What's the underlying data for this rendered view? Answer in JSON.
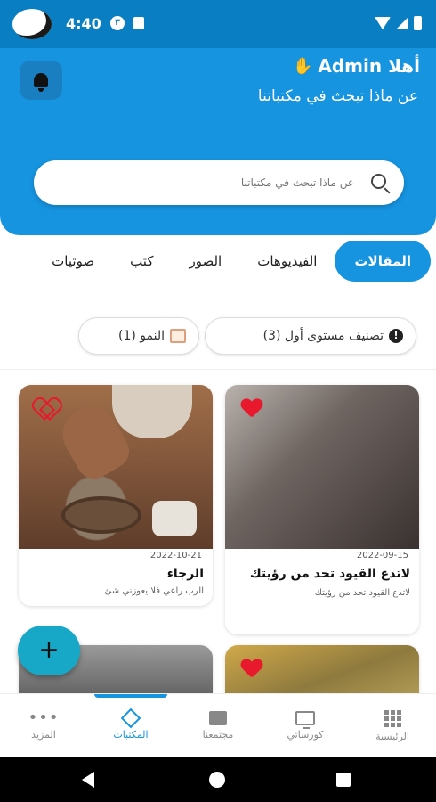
{
  "status_bar": {
    "time": "4:40",
    "notif_badge": "۳"
  },
  "header": {
    "greeting": "أهلا Admin",
    "subtitle": "عن ماذا تبحث في مكتباتنا",
    "search_placeholder": "عن ماذا تبحث في مكتباتنا"
  },
  "tabs": [
    {
      "label": "المقالات",
      "active": true
    },
    {
      "label": "الفيديوهات",
      "active": false
    },
    {
      "label": "الصور",
      "active": false
    },
    {
      "label": "كتب",
      "active": false
    },
    {
      "label": "صوتيات",
      "active": false
    }
  ],
  "filters": [
    {
      "label": "تصنيف مستوى أول (3)",
      "icon": "info-icon"
    },
    {
      "label": "النمو (1)",
      "icon": "calendar-icon"
    }
  ],
  "cards": [
    {
      "date": "2022-09-15",
      "title": "لاتدع القيود تحد من رؤيتك",
      "excerpt": "لاتدع القيود تحد من رؤيتك",
      "favorite": true
    },
    {
      "date": "2022-10-21",
      "title": "الرجاء",
      "excerpt": "الرب راعي فلا يعوزني شئ",
      "favorite": false
    }
  ],
  "fab": {
    "label": "+"
  },
  "bottom_nav": [
    {
      "label": "الرئيسية",
      "icon": "grid-icon",
      "active": false
    },
    {
      "label": "كورساتي",
      "icon": "monitor-icon",
      "active": false
    },
    {
      "label": "مجتمعنا",
      "icon": "chat-icon",
      "active": false
    },
    {
      "label": "المكتبات",
      "icon": "layers-icon",
      "active": true
    },
    {
      "label": "المزيد",
      "icon": "more-dots-icon",
      "active": false
    }
  ],
  "colors": {
    "primary": "#1694e0",
    "status_bar": "#0a7ec2",
    "heart": "#e8192c",
    "fab": "#17a8c8"
  }
}
